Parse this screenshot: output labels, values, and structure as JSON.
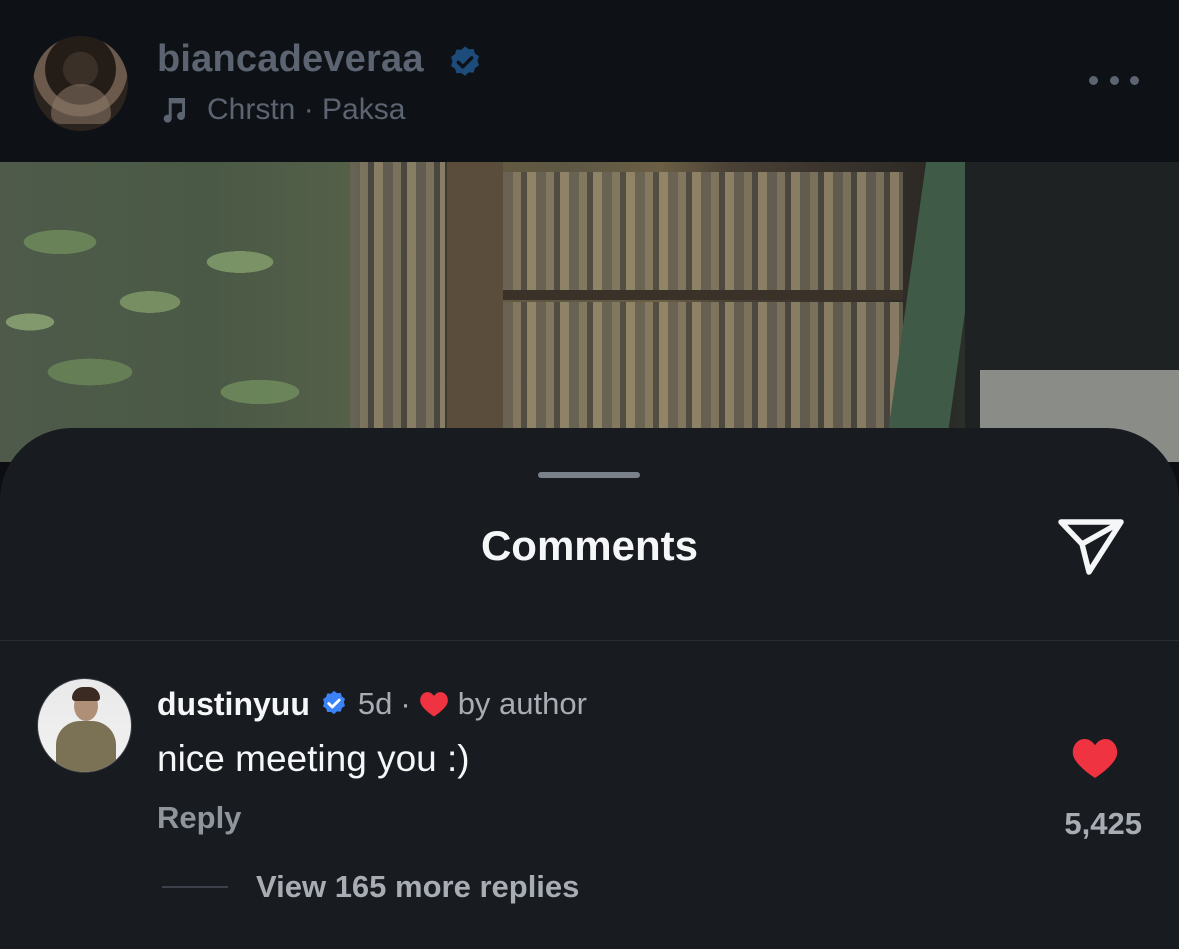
{
  "post": {
    "username": "biancadeveraa",
    "verified": true,
    "music_label": "Chrstn · Paksa",
    "icons": {
      "music": "music-note-icon",
      "more": "more-horizontal-icon",
      "verified": "verified-badge-icon"
    }
  },
  "sheet": {
    "title": "Comments",
    "send_icon": "send-icon"
  },
  "comment": {
    "username": "dustinyuu",
    "verified": true,
    "age": "5d",
    "separator": "·",
    "liked_by_author_label": "by author",
    "text": "nice meeting you :)",
    "reply_label": "Reply",
    "like_count": "5,425",
    "view_replies_label": "View 165 more replies"
  },
  "colors": {
    "verified_blue": "#3b82f6",
    "like_red": "#ef3340",
    "sheet_background": "#181b20",
    "primary_text": "#f5f6f7",
    "secondary_text": "#a8adb4"
  }
}
